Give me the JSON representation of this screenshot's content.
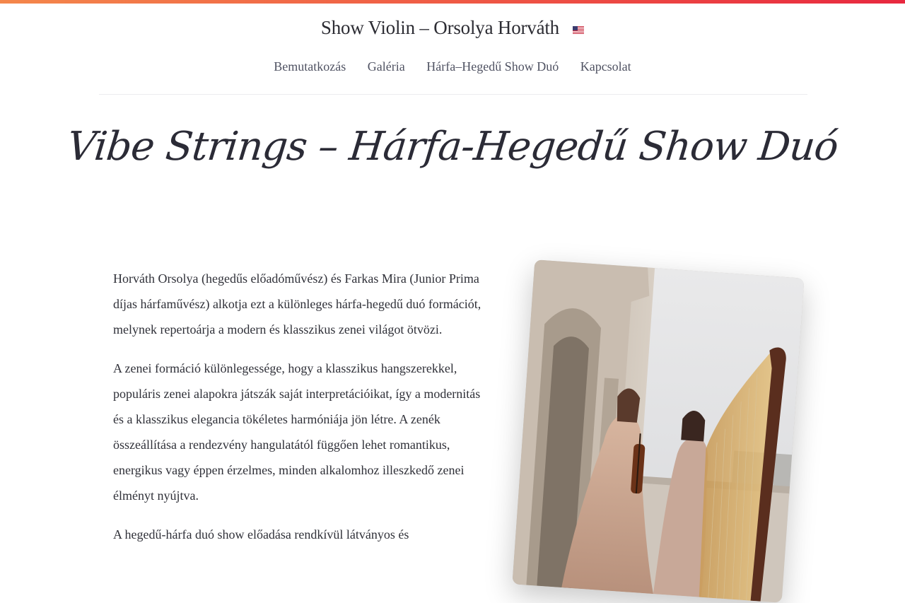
{
  "site": {
    "title": "Show Violin – Orsolya Horváth",
    "language_flag": "us-flag-icon"
  },
  "nav": {
    "items": [
      {
        "label": "Bemutatkozás"
      },
      {
        "label": "Galéria"
      },
      {
        "label": "Hárfa–Hegedű Show Duó"
      },
      {
        "label": "Kapcsolat"
      }
    ]
  },
  "page": {
    "title": "Vibe Strings – Hárfa-Hegedű Show Duó",
    "paragraphs": [
      "Horváth Orsolya (hegedűs előadóművész) és Farkas Mira (Junior Prima díjas hárfaművész) alkotja ezt a különleges hárfa-hegedű duó formációt, melynek repertoárja a modern és klasszikus zenei világot ötvözi.",
      "A zenei formáció különlegessége, hogy a klasszikus hangszerekkel, populáris zenei alapokra játszák saját interpretációikat, így a modernitás és a klasszikus elegancia tökéletes harmóniája jön létre. A zenék összeállítása a rendezvény hangulatától függően lehet romantikus, energikus vagy éppen érzelmes, minden alkalomhoz illeszkedő zenei élményt nyújtva.",
      "A hegedű-hárfa duó show előadása rendkívül látványos és"
    ]
  },
  "colors": {
    "accent_gradient_start": "#f4874b",
    "accent_gradient_end": "#e8283f",
    "text": "#2f3038",
    "nav_text": "#4f5262"
  }
}
